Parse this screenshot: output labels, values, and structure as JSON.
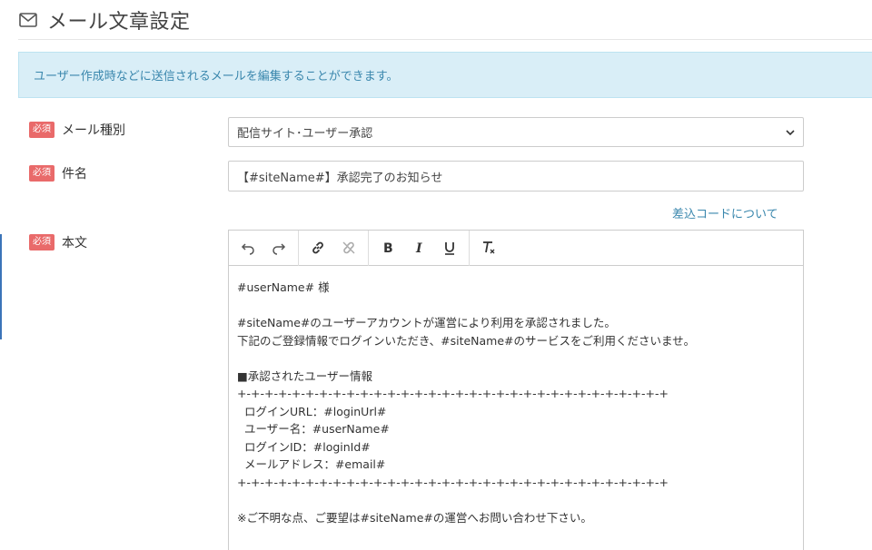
{
  "header": {
    "title": "メール文章設定",
    "icon": "mail-icon"
  },
  "alert": {
    "text": "ユーザー作成時などに送信されるメールを編集することができます。"
  },
  "required_badge": "必須",
  "fields": {
    "mail_type": {
      "label": "メール種別",
      "value": "配信サイト･ユーザー承認"
    },
    "subject": {
      "label": "件名",
      "value": "【#siteName#】承認完了のお知らせ"
    },
    "body": {
      "label": "本文"
    }
  },
  "link_text": "差込コードについて",
  "toolbar": [
    "undo-icon",
    "redo-icon",
    "link-icon",
    "unlink-icon",
    "bold-icon",
    "italic-icon",
    "underline-icon",
    "clear-format-icon"
  ],
  "body_lines": [
    "#userName# 様",
    "",
    "#siteName#のユーザーアカウントが運営により利用を承認されました。",
    "下記のご登録情報でログインいただき、#siteName#のサービスをご利用くださいませ。",
    "",
    "■承認されたユーザー情報",
    "+-+-+-+-+-+-+-+-+-+-+-+-+-+-+-+-+-+-+-+-+-+-+-+-+-+-+-+-+-+-+-+",
    "  ログインURL：#loginUrl#",
    "  ユーザー名：#userName#",
    "  ログインID：#loginId#",
    "  メールアドレス：#email#",
    "+-+-+-+-+-+-+-+-+-+-+-+-+-+-+-+-+-+-+-+-+-+-+-+-+-+-+-+-+-+-+-+",
    "",
    "※ご不明な点、ご要望は#siteName#の運営へお問い合わせ下さい。"
  ],
  "colors": {
    "accent": "#3a87ad",
    "required": "#e96a6a",
    "alert_bg": "#d9eef7"
  }
}
